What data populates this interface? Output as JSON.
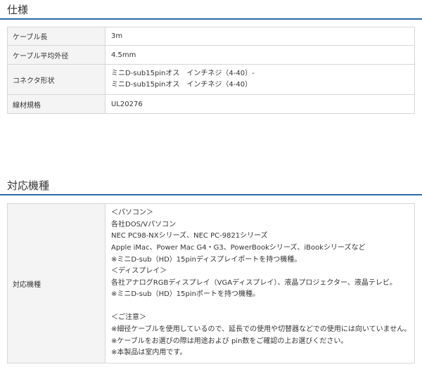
{
  "spec": {
    "title": "仕様",
    "rows": [
      {
        "label": "ケーブル長",
        "value": "3m"
      },
      {
        "label": "ケーブル平均外径",
        "value": "4.5mm"
      },
      {
        "label": "コネクタ形状",
        "lines": [
          "ミニD-sub15pinオス　インチネジ（4-40）-",
          "ミニD-sub15pinオス　インチネジ（4-40）"
        ]
      },
      {
        "label": "線材規格",
        "value": "UL20276"
      }
    ]
  },
  "compat": {
    "title": "対応機種",
    "label": "対応機種",
    "lines": [
      "＜パソコン＞",
      "各社DOS/Vパソコン",
      "NEC PC98-NXシリーズ、NEC PC-9821シリーズ",
      "Apple iMac、Power Mac G4・G3、PowerBookシリーズ、iBookシリーズなど",
      "※ミニD-sub（HD）15pinディスプレイポートを持つ機種。",
      "＜ディスプレイ＞",
      "各社アナログRGBディスプレイ（VGAディスプレイ）、液晶プロジェクター、液晶テレビ。",
      "※ミニD-sub（HD）15pinポートを持つ機種。",
      "",
      "＜ご注意＞",
      "※細径ケーブルを使用しているので、延長での使用や切替器などでの使用には向いていません。",
      "※ケーブルをお選びの際は用途および pin数をご確認の上お選びください。",
      "※本製品は室内用です。"
    ]
  },
  "colors": {
    "accent_rule": "#2c6aa6",
    "label_bg": "#f4f4f4",
    "border": "#d6d6d6"
  }
}
